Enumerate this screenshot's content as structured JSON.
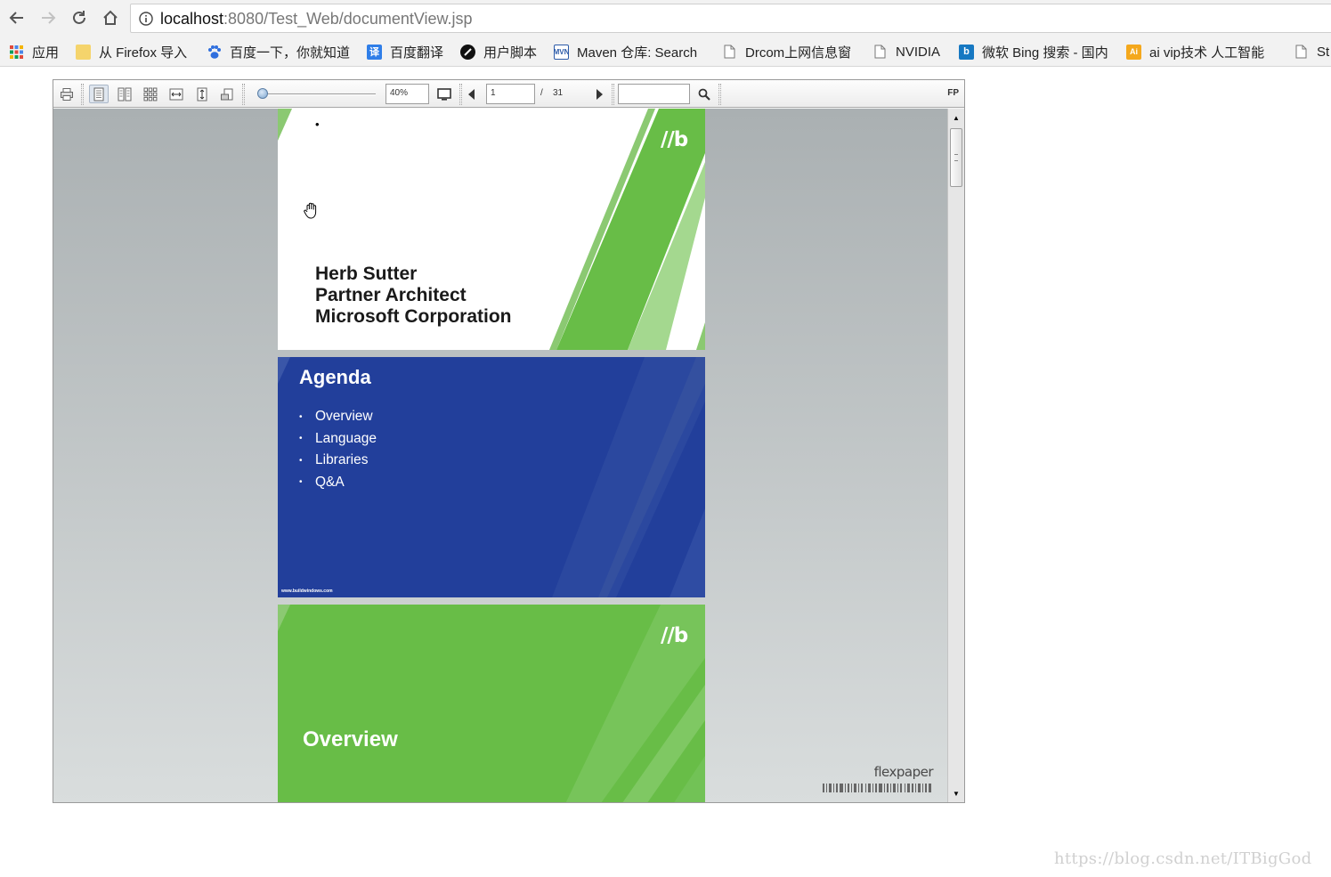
{
  "browser": {
    "url_host": "localhost",
    "url_rest": ":8080/Test_Web/documentView.jsp",
    "bookmarks": [
      {
        "label": "应用",
        "icon": "apps-grid-icon",
        "color": "#e04a3a"
      },
      {
        "label": "从 Firefox 导入",
        "icon": "folder-icon",
        "color": "#f5d46c"
      },
      {
        "label": "百度一下，你就知道",
        "icon": "baidu-paw-icon",
        "color": "#2f6fde"
      },
      {
        "label": "百度翻译",
        "icon": "baidu-translate-icon",
        "color": "#2f7ee8"
      },
      {
        "label": "用户脚本",
        "icon": "userscript-icon",
        "color": "#111111"
      },
      {
        "label": "Maven 仓库: Search",
        "icon": "maven-icon",
        "color": "#2b5aa8"
      },
      {
        "label": "Drcom上网信息窗",
        "icon": "page-icon",
        "color": "#777777"
      },
      {
        "label": "NVIDIA",
        "icon": "page-icon",
        "color": "#777777"
      },
      {
        "label": "微软 Bing 搜索 - 国内",
        "icon": "bing-icon",
        "color": "#1678c2"
      },
      {
        "label": "ai vip技术 人工智能",
        "icon": "ai-icon",
        "color": "#f4a81d"
      },
      {
        "label": "St",
        "icon": "page-icon",
        "color": "#777777"
      }
    ]
  },
  "viewer": {
    "zoom": "40%",
    "current_page": "1",
    "page_separator": "/",
    "total_pages": "31",
    "search_value": "",
    "brand": "FP",
    "scroll_fraction": 0.0
  },
  "slides": {
    "slide1": {
      "logo": "//b",
      "lines": [
        "Herb Sutter",
        "Partner Architect",
        "Microsoft Corporation"
      ],
      "bullet": "•"
    },
    "slide2": {
      "title": "Agenda",
      "items": [
        "Overview",
        "Language",
        "Libraries",
        "Q&A"
      ],
      "bullet": "•",
      "footer": "www.buildwindows.com"
    },
    "slide3": {
      "logo": "//b",
      "title": "Overview"
    }
  },
  "watermark": {
    "flexpaper": "flexpaper",
    "csdn": "https://blog.csdn.net/ITBigGod"
  }
}
